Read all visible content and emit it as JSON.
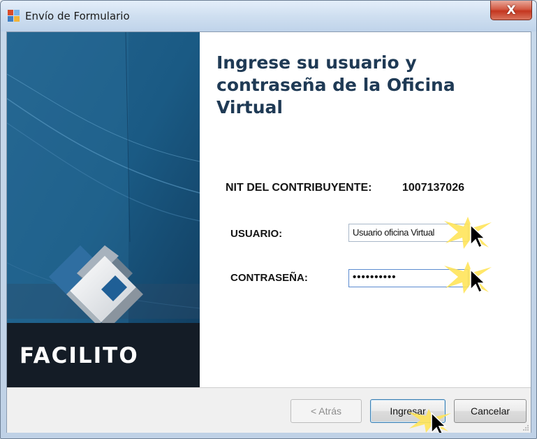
{
  "window": {
    "title": "Envío de Formulario",
    "close_label": "X"
  },
  "banner": {
    "brand": "FACILITO"
  },
  "form": {
    "heading_line1": "Ingrese su usuario y",
    "heading_line2": "contraseña de la Oficina",
    "heading_line3": "Virtual",
    "nit_label": "NIT DEL CONTRIBUYENTE:",
    "nit_value": "1007137026",
    "user_label": "USUARIO:",
    "user_value": "Usuario oficina Virtual",
    "password_label": "CONTRASEÑA:",
    "password_value": "••••••••••"
  },
  "buttons": {
    "back": "< Atrás",
    "submit": "Ingresar",
    "cancel": "Cancelar"
  },
  "colors": {
    "banner_blue": "#1d5a86",
    "banner_dark": "#141c26",
    "heading": "#1f3a55"
  },
  "icons": [
    "app-icon",
    "close-icon",
    "cursor-icon",
    "resize-grip-icon"
  ]
}
